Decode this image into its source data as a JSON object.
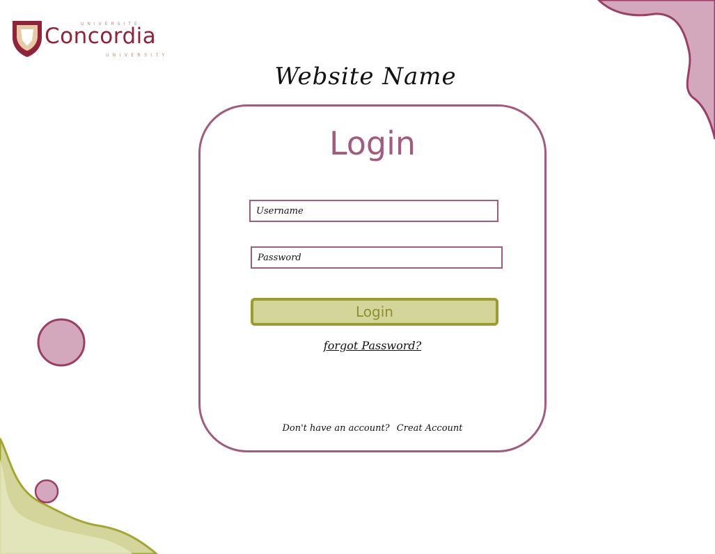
{
  "logo": {
    "top_text": "UNIVERSITÉ",
    "name": "Concordia",
    "bottom_text": "UNIVERSITY"
  },
  "site": {
    "name": "Website Name"
  },
  "login_form": {
    "title": "Login",
    "username_placeholder": "Username",
    "password_placeholder": "Password",
    "login_button": "Login",
    "forgot_password": "forgot Password?",
    "no_account_text": "Don't have an account?",
    "create_account": "Creat Account"
  },
  "colors": {
    "accent": "#a25a7f",
    "blob_pink": "#d3a8bd",
    "blob_olive": "#d3d59a",
    "button_fill": "#d3d59a",
    "button_border": "#9a9c2c",
    "brand": "#912338"
  }
}
